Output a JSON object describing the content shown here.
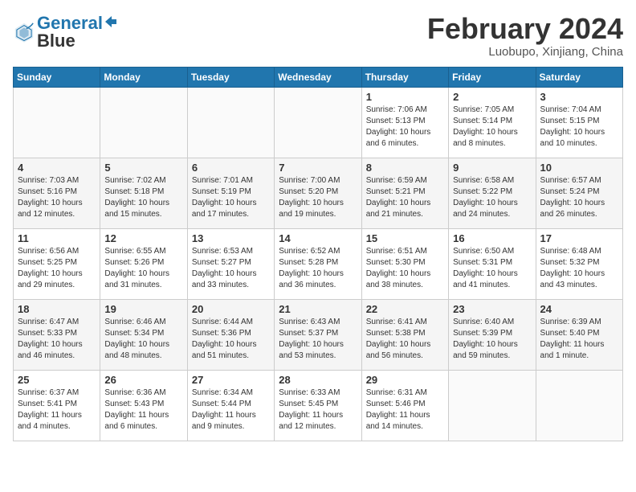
{
  "header": {
    "logo_line1": "General",
    "logo_line2": "Blue",
    "month_title": "February 2024",
    "location": "Luobupo, Xinjiang, China"
  },
  "days_of_week": [
    "Sunday",
    "Monday",
    "Tuesday",
    "Wednesday",
    "Thursday",
    "Friday",
    "Saturday"
  ],
  "weeks": [
    [
      {
        "day": "",
        "info": ""
      },
      {
        "day": "",
        "info": ""
      },
      {
        "day": "",
        "info": ""
      },
      {
        "day": "",
        "info": ""
      },
      {
        "day": "1",
        "info": "Sunrise: 7:06 AM\nSunset: 5:13 PM\nDaylight: 10 hours\nand 6 minutes."
      },
      {
        "day": "2",
        "info": "Sunrise: 7:05 AM\nSunset: 5:14 PM\nDaylight: 10 hours\nand 8 minutes."
      },
      {
        "day": "3",
        "info": "Sunrise: 7:04 AM\nSunset: 5:15 PM\nDaylight: 10 hours\nand 10 minutes."
      }
    ],
    [
      {
        "day": "4",
        "info": "Sunrise: 7:03 AM\nSunset: 5:16 PM\nDaylight: 10 hours\nand 12 minutes."
      },
      {
        "day": "5",
        "info": "Sunrise: 7:02 AM\nSunset: 5:18 PM\nDaylight: 10 hours\nand 15 minutes."
      },
      {
        "day": "6",
        "info": "Sunrise: 7:01 AM\nSunset: 5:19 PM\nDaylight: 10 hours\nand 17 minutes."
      },
      {
        "day": "7",
        "info": "Sunrise: 7:00 AM\nSunset: 5:20 PM\nDaylight: 10 hours\nand 19 minutes."
      },
      {
        "day": "8",
        "info": "Sunrise: 6:59 AM\nSunset: 5:21 PM\nDaylight: 10 hours\nand 21 minutes."
      },
      {
        "day": "9",
        "info": "Sunrise: 6:58 AM\nSunset: 5:22 PM\nDaylight: 10 hours\nand 24 minutes."
      },
      {
        "day": "10",
        "info": "Sunrise: 6:57 AM\nSunset: 5:24 PM\nDaylight: 10 hours\nand 26 minutes."
      }
    ],
    [
      {
        "day": "11",
        "info": "Sunrise: 6:56 AM\nSunset: 5:25 PM\nDaylight: 10 hours\nand 29 minutes."
      },
      {
        "day": "12",
        "info": "Sunrise: 6:55 AM\nSunset: 5:26 PM\nDaylight: 10 hours\nand 31 minutes."
      },
      {
        "day": "13",
        "info": "Sunrise: 6:53 AM\nSunset: 5:27 PM\nDaylight: 10 hours\nand 33 minutes."
      },
      {
        "day": "14",
        "info": "Sunrise: 6:52 AM\nSunset: 5:28 PM\nDaylight: 10 hours\nand 36 minutes."
      },
      {
        "day": "15",
        "info": "Sunrise: 6:51 AM\nSunset: 5:30 PM\nDaylight: 10 hours\nand 38 minutes."
      },
      {
        "day": "16",
        "info": "Sunrise: 6:50 AM\nSunset: 5:31 PM\nDaylight: 10 hours\nand 41 minutes."
      },
      {
        "day": "17",
        "info": "Sunrise: 6:48 AM\nSunset: 5:32 PM\nDaylight: 10 hours\nand 43 minutes."
      }
    ],
    [
      {
        "day": "18",
        "info": "Sunrise: 6:47 AM\nSunset: 5:33 PM\nDaylight: 10 hours\nand 46 minutes."
      },
      {
        "day": "19",
        "info": "Sunrise: 6:46 AM\nSunset: 5:34 PM\nDaylight: 10 hours\nand 48 minutes."
      },
      {
        "day": "20",
        "info": "Sunrise: 6:44 AM\nSunset: 5:36 PM\nDaylight: 10 hours\nand 51 minutes."
      },
      {
        "day": "21",
        "info": "Sunrise: 6:43 AM\nSunset: 5:37 PM\nDaylight: 10 hours\nand 53 minutes."
      },
      {
        "day": "22",
        "info": "Sunrise: 6:41 AM\nSunset: 5:38 PM\nDaylight: 10 hours\nand 56 minutes."
      },
      {
        "day": "23",
        "info": "Sunrise: 6:40 AM\nSunset: 5:39 PM\nDaylight: 10 hours\nand 59 minutes."
      },
      {
        "day": "24",
        "info": "Sunrise: 6:39 AM\nSunset: 5:40 PM\nDaylight: 11 hours\nand 1 minute."
      }
    ],
    [
      {
        "day": "25",
        "info": "Sunrise: 6:37 AM\nSunset: 5:41 PM\nDaylight: 11 hours\nand 4 minutes."
      },
      {
        "day": "26",
        "info": "Sunrise: 6:36 AM\nSunset: 5:43 PM\nDaylight: 11 hours\nand 6 minutes."
      },
      {
        "day": "27",
        "info": "Sunrise: 6:34 AM\nSunset: 5:44 PM\nDaylight: 11 hours\nand 9 minutes."
      },
      {
        "day": "28",
        "info": "Sunrise: 6:33 AM\nSunset: 5:45 PM\nDaylight: 11 hours\nand 12 minutes."
      },
      {
        "day": "29",
        "info": "Sunrise: 6:31 AM\nSunset: 5:46 PM\nDaylight: 11 hours\nand 14 minutes."
      },
      {
        "day": "",
        "info": ""
      },
      {
        "day": "",
        "info": ""
      }
    ]
  ]
}
